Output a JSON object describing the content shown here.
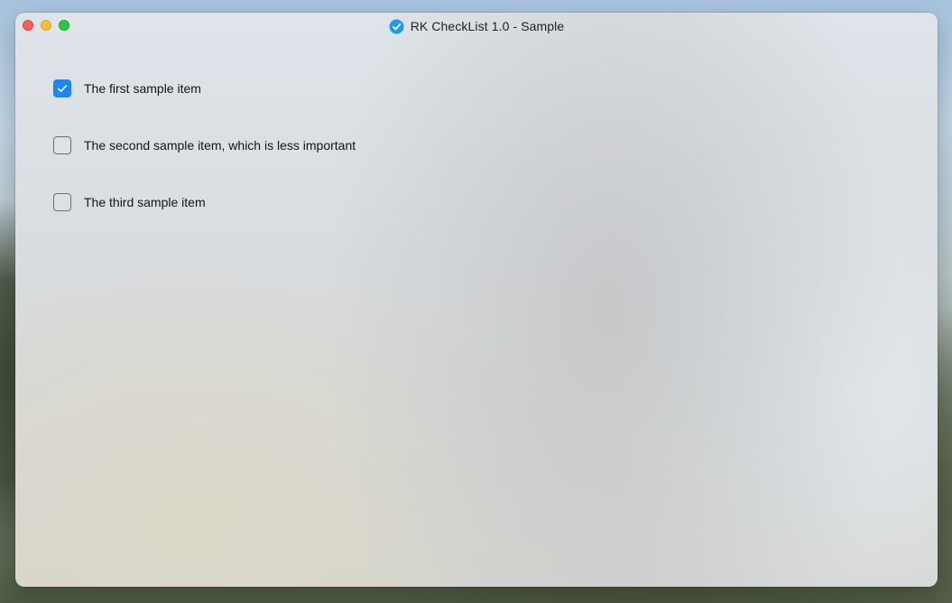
{
  "window": {
    "title": "RK CheckList 1.0 - Sample",
    "app_icon": "checkmark-circle-icon",
    "app_icon_color": "#1a9bf0"
  },
  "checklist": {
    "accent_color": "#1a87f5",
    "items": [
      {
        "label": "The first sample item",
        "checked": true
      },
      {
        "label": "The second sample item, which is less important",
        "checked": false
      },
      {
        "label": "The third sample item",
        "checked": false
      }
    ]
  }
}
